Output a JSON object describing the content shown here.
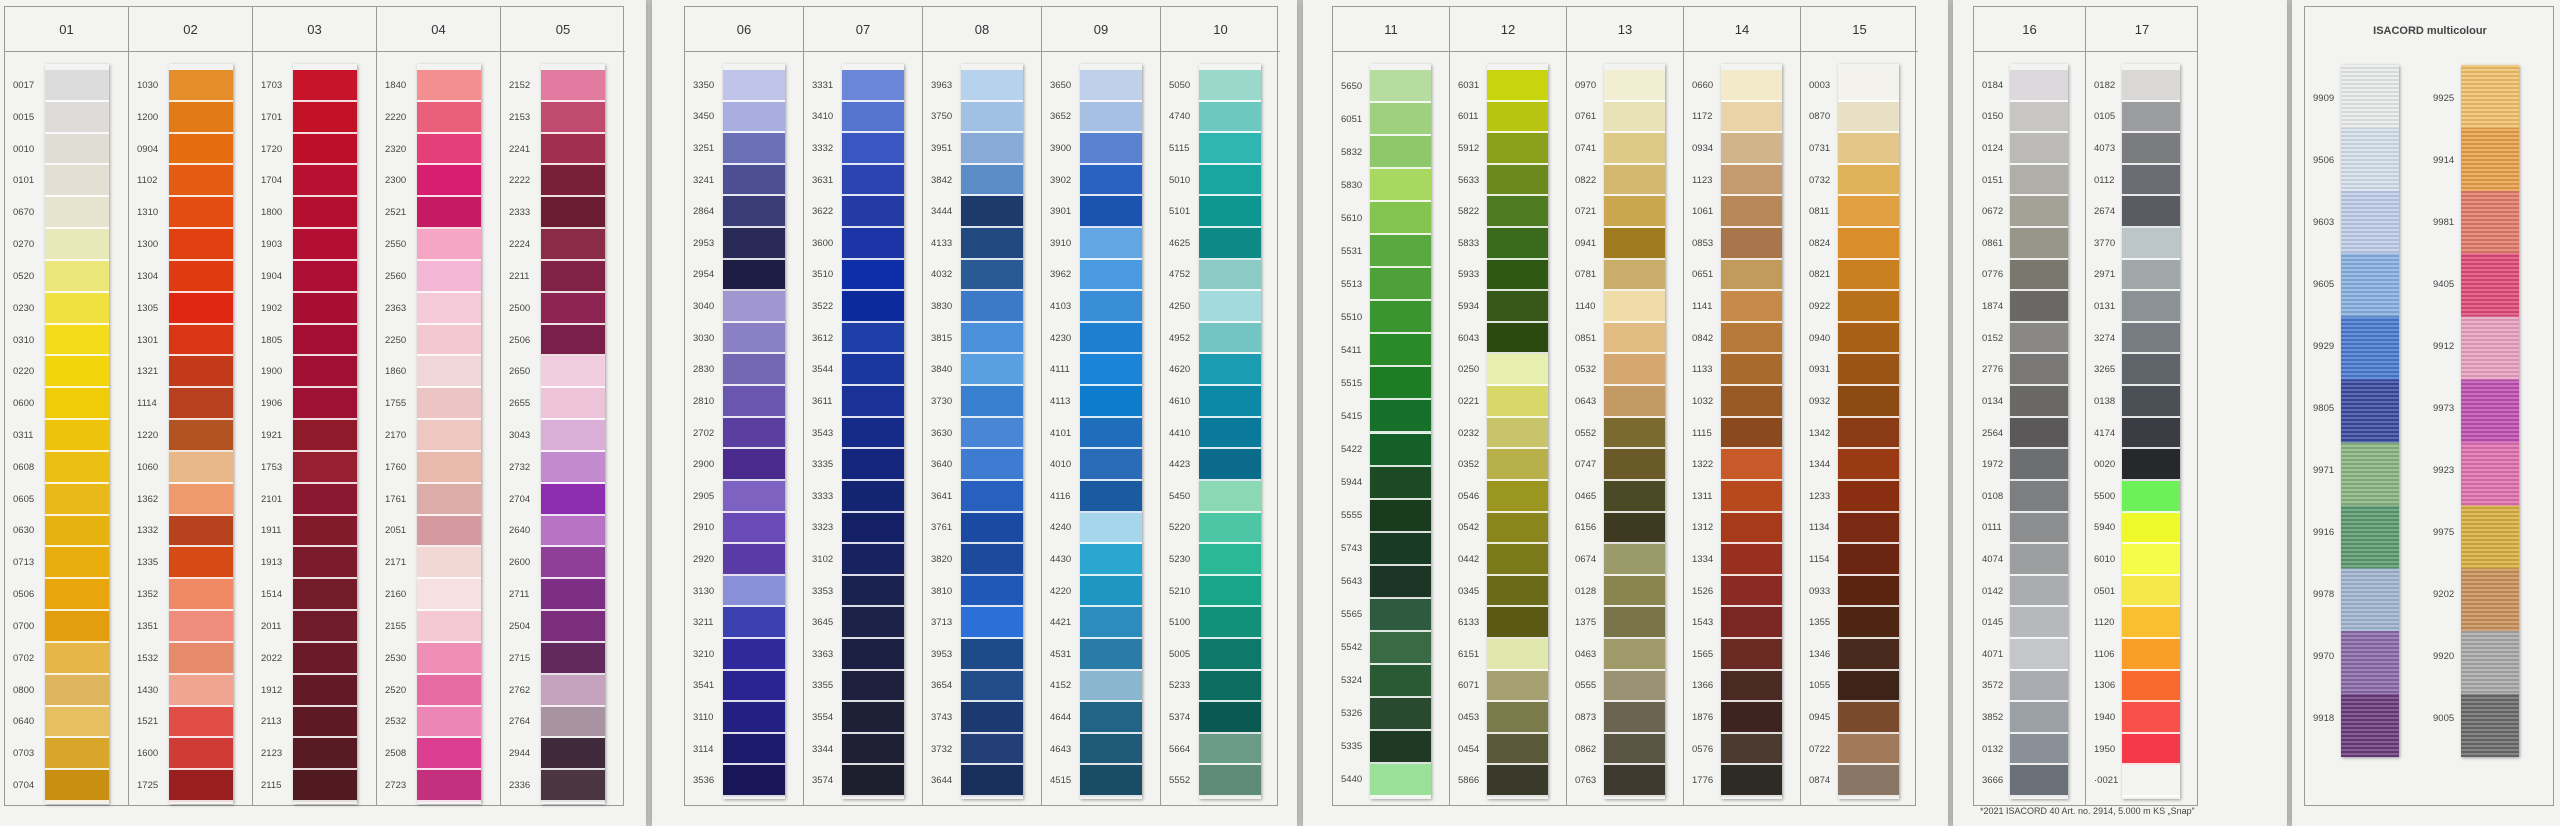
{
  "cards": [
    {
      "columns": [
        {
          "title": "01",
          "codes": [
            "0017",
            "0015",
            "0010",
            "0101",
            "0670",
            "0270",
            "0520",
            "0230",
            "0310",
            "0220",
            "0600",
            "0311",
            "0608",
            "0605",
            "0630",
            "0713",
            "0506",
            "0700",
            "0702",
            "0800",
            "0640",
            "0703",
            "0704"
          ],
          "colors": [
            "#dcdcdc",
            "#dedcd9",
            "#e0ddd5",
            "#e3e0d3",
            "#e6e3cf",
            "#e9e8b8",
            "#ece67a",
            "#f0e040",
            "#f3dc1a",
            "#f2d50c",
            "#efcb08",
            "#eec30b",
            "#ecbf16",
            "#e9b91a",
            "#e6b20f",
            "#e9ad0d",
            "#e9a60c",
            "#e39e10",
            "#e7b648",
            "#dcb55c",
            "#e6c060",
            "#d8a62a",
            "#c88f10"
          ]
        },
        {
          "title": "02",
          "codes": [
            "1030",
            "1200",
            "0904",
            "1102",
            "1310",
            "1300",
            "1304",
            "1305",
            "1301",
            "1321",
            "1114",
            "1220",
            "1060",
            "1362",
            "1332",
            "1335",
            "1352",
            "1351",
            "1532",
            "1430",
            "1521",
            "1600",
            "1725"
          ],
          "colors": [
            "#e58d28",
            "#e27a19",
            "#e66c12",
            "#e45c12",
            "#e34d11",
            "#e14110",
            "#df3a12",
            "#e02712",
            "#d83614",
            "#c23a1a",
            "#b8401e",
            "#b35223",
            "#e9b88a",
            "#ef9a6c",
            "#b7421e",
            "#d64a16",
            "#f08a66",
            "#f08c7c",
            "#e58a6a",
            "#f0a492",
            "#e04d45",
            "#d03a37",
            "#9a2020"
          ]
        },
        {
          "title": "03",
          "codes": [
            "1703",
            "1701",
            "1720",
            "1704",
            "1800",
            "1903",
            "1904",
            "1902",
            "1805",
            "1900",
            "1906",
            "1921",
            "1753",
            "2101",
            "1911",
            "1913",
            "1514",
            "2011",
            "2022",
            "1912",
            "2113",
            "2123",
            "2115"
          ],
          "colors": [
            "#c8142a",
            "#c31226",
            "#bd1028",
            "#b81030",
            "#b40f2e",
            "#b20f32",
            "#ad0f34",
            "#a80e32",
            "#a40e33",
            "#a10f32",
            "#9e1034",
            "#8f1a2a",
            "#962032",
            "#8c1730",
            "#831a2c",
            "#7c1b2c",
            "#751c2a",
            "#701b2a",
            "#6a1a28",
            "#641a26",
            "#5e1a24",
            "#581a22",
            "#501a20"
          ]
        },
        {
          "title": "04",
          "codes": [
            "1840",
            "2220",
            "2320",
            "2300",
            "2521",
            "2550",
            "2560",
            "2363",
            "2250",
            "1860",
            "1755",
            "2170",
            "1760",
            "1761",
            "2051",
            "2171",
            "2160",
            "2155",
            "2530",
            "2520",
            "2532",
            "2508",
            "2723"
          ],
          "colors": [
            "#f38f8e",
            "#e9607a",
            "#e43f78",
            "#d81e70",
            "#c51a64",
            "#f4a6c4",
            "#f3b6d4",
            "#f5cad8",
            "#f3c9cf",
            "#f1d6d8",
            "#ecc4c4",
            "#eec8c0",
            "#eab9ae",
            "#dcada8",
            "#d59aa0",
            "#f2d8d4",
            "#f6e0e0",
            "#f4c9d5",
            "#ef8fb8",
            "#e66ba2",
            "#ec86b4",
            "#dc3f92",
            "#c2307e"
          ]
        },
        {
          "title": "05",
          "codes": [
            "2152",
            "2153",
            "2241",
            "2222",
            "2333",
            "2224",
            "2211",
            "2500",
            "2506",
            "2650",
            "2655",
            "3043",
            "2732",
            "2704",
            "2640",
            "2600",
            "2711",
            "2504",
            "2715",
            "2762",
            "2764",
            "2944",
            "2336"
          ],
          "colors": [
            "#e27ba0",
            "#c04a70",
            "#a0304e",
            "#7a1f38",
            "#6a1c33",
            "#8b2b4a",
            "#7f2245",
            "#8d2552",
            "#7a1e4a",
            "#f2cde0",
            "#ecc3d8",
            "#d9aed7",
            "#c28bd0",
            "#8f2db0",
            "#b774c4",
            "#8f3f98",
            "#7d2f86",
            "#7a2e7c",
            "#622a5c",
            "#c5a3bf",
            "#a893a2",
            "#3e2a3a",
            "#4a3540"
          ]
        }
      ]
    },
    {
      "columns": [
        {
          "title": "06",
          "codes": [
            "3350",
            "3450",
            "3251",
            "3241",
            "2864",
            "2953",
            "2954",
            "3040",
            "3030",
            "2830",
            "2810",
            "2702",
            "2900",
            "2905",
            "2910",
            "2920",
            "3130",
            "3211",
            "3210",
            "3541",
            "3110",
            "3114",
            "3536"
          ],
          "colors": [
            "#c0c4e8",
            "#a8aee0",
            "#6c70b6",
            "#4c4f92",
            "#3a3c78",
            "#2a2a58",
            "#1e1e44",
            "#a096d0",
            "#8a80c6",
            "#7468b4",
            "#6a56ae",
            "#5a3ea0",
            "#4a2a8c",
            "#7e62c2",
            "#6a4ab6",
            "#5a3aa4",
            "#8a90d8",
            "#3a40b0",
            "#2e2a9c",
            "#2a2490",
            "#222080",
            "#1c1a6a",
            "#181656"
          ]
        },
        {
          "title": "07",
          "codes": [
            "3331",
            "3410",
            "3332",
            "3631",
            "3622",
            "3600",
            "3510",
            "3522",
            "3612",
            "3544",
            "3611",
            "3543",
            "3335",
            "3333",
            "3323",
            "3102",
            "3353",
            "3645",
            "3363",
            "3355",
            "3554",
            "3344",
            "3574"
          ],
          "colors": [
            "#6a86d8",
            "#5474d0",
            "#3a56c0",
            "#2c44b0",
            "#243aa4",
            "#1c34a6",
            "#0e2ea8",
            "#0c2a9c",
            "#1e3ea8",
            "#1c36a0",
            "#1a3298",
            "#162a8a",
            "#14267e",
            "#132470",
            "#142066",
            "#18225e",
            "#1a2250",
            "#1c2248",
            "#1c2042",
            "#1e213e",
            "#1e2038",
            "#1f2034",
            "#1d1e2e"
          ]
        },
        {
          "title": "08",
          "codes": [
            "3963",
            "3750",
            "3951",
            "3842",
            "3444",
            "4133",
            "4032",
            "3830",
            "3815",
            "3840",
            "3730",
            "3630",
            "3640",
            "3641",
            "3761",
            "3820",
            "3810",
            "3713",
            "3953",
            "3654",
            "3743",
            "3732",
            "3644"
          ],
          "colors": [
            "#b6d2ec",
            "#a0c0e4",
            "#88aad6",
            "#5a8cc6",
            "#1e3a6a",
            "#214a80",
            "#2a5a96",
            "#3a7ac6",
            "#4a90da",
            "#5aa0e0",
            "#3880d0",
            "#4a86d6",
            "#3e7cd2",
            "#2860c0",
            "#1a4aa2",
            "#1c4a9c",
            "#2058b8",
            "#2a70d8",
            "#1e4a8a",
            "#224c8a",
            "#1c3a70",
            "#243e76",
            "#1a2e5c"
          ]
        },
        {
          "title": "09",
          "codes": [
            "3650",
            "3652",
            "3900",
            "3902",
            "3901",
            "3910",
            "3962",
            "4103",
            "4230",
            "4111",
            "4113",
            "4101",
            "4010",
            "4116",
            "4240",
            "4430",
            "4220",
            "4421",
            "4531",
            "4152",
            "4644",
            "4643",
            "4515"
          ],
          "colors": [
            "#c0d0ea",
            "#a6c0e4",
            "#5a82d0",
            "#2a62c2",
            "#1a54b0",
            "#62a6e4",
            "#4a9ae0",
            "#3a8ed8",
            "#1e7ed0",
            "#1a84d8",
            "#0e7ccc",
            "#1e6ebc",
            "#2a6cb8",
            "#1a5aa0",
            "#a6d6ec",
            "#2aa6d0",
            "#1e96c4",
            "#2c8cbc",
            "#2a7ca6",
            "#8ab6d0",
            "#226486",
            "#1e5a78",
            "#1a4c66"
          ]
        },
        {
          "title": "10",
          "codes": [
            "5050",
            "4740",
            "5115",
            "5010",
            "5101",
            "4625",
            "4752",
            "4250",
            "4952",
            "4620",
            "4610",
            "4410",
            "4423",
            "5450",
            "5220",
            "5230",
            "5210",
            "5100",
            "5005",
            "5233",
            "5374",
            "5664",
            "5552"
          ],
          "colors": [
            "#9ad8cc",
            "#6cc8c0",
            "#30b6b0",
            "#1aa6a0",
            "#0e9690",
            "#0e8a86",
            "#8ccac6",
            "#a4dade",
            "#74c4c4",
            "#1c9cb0",
            "#0a88a6",
            "#0a7a9a",
            "#0a6c8a",
            "#8ad8b4",
            "#4cc6a4",
            "#2ab896",
            "#18a688",
            "#12907a",
            "#0e786a",
            "#0c6c60",
            "#0a5a52",
            "#6a9a88",
            "#5e8a78"
          ]
        }
      ]
    },
    {
      "columns": [
        {
          "title": "11",
          "codes": [
            "5650",
            "6051",
            "5832",
            "5830",
            "5610",
            "5531",
            "5513",
            "5510",
            "5411",
            "5515",
            "5415",
            "5422",
            "5944",
            "5555",
            "5743",
            "5643",
            "5565",
            "5542",
            "5324",
            "5326",
            "5335",
            "5440"
          ],
          "colors": [
            "#b6dca0",
            "#9ed07e",
            "#8ec86a",
            "#a8d860",
            "#84c450",
            "#5aa840",
            "#4ea038",
            "#3a9430",
            "#2a8a2a",
            "#1e7c26",
            "#16702a",
            "#146028",
            "#1c4a22",
            "#1a3a1e",
            "#193a24",
            "#1c3626",
            "#2e5a40",
            "#3a6a44",
            "#2a5a34",
            "#2a4a30",
            "#1e3a24",
            "#9ae098"
          ]
        },
        {
          "title": "12",
          "codes": [
            "6031",
            "6011",
            "5912",
            "5633",
            "5822",
            "5833",
            "5933",
            "5934",
            "6043",
            "0250",
            "0221",
            "0232",
            "0352",
            "0546",
            "0542",
            "0442",
            "0345",
            "6133",
            "6151",
            "6071",
            "0453",
            "0454",
            "5866"
          ],
          "colors": [
            "#c8d40e",
            "#b8c412",
            "#8aa01a",
            "#6a8a1e",
            "#4e7a20",
            "#3a6a1c",
            "#2e5814",
            "#38581a",
            "#2a4a10",
            "#e8f0b0",
            "#d8d868",
            "#c8c46a",
            "#b8b04a",
            "#9a9620",
            "#8a861e",
            "#7a7a1a",
            "#6a6a1a",
            "#5a5a14",
            "#e0e8b0",
            "#a4a070",
            "#7a7a4a",
            "#5a5a3a",
            "#3a3a2a"
          ]
        },
        {
          "title": "13",
          "codes": [
            "0970",
            "0761",
            "0741",
            "0822",
            "0721",
            "0941",
            "0781",
            "1140",
            "0851",
            "0532",
            "0643",
            "0552",
            "0747",
            "0465",
            "6156",
            "0674",
            "0128",
            "1375",
            "0463",
            "0555",
            "0873",
            "0862",
            "0763"
          ],
          "colors": [
            "#f2eed4",
            "#e8e2b6",
            "#dcca86",
            "#d2b870",
            "#caa64e",
            "#a07a1e",
            "#c8ae6a",
            "#f0dca8",
            "#e0bc82",
            "#d4a870",
            "#c49a64",
            "#7a6a30",
            "#6a5a2a",
            "#4a4a26",
            "#3e3a22",
            "#9a9a6a",
            "#8a8450",
            "#7a744a",
            "#a09a6a",
            "#9a9272",
            "#6a6450",
            "#5a5444",
            "#3e3a30"
          ]
        },
        {
          "title": "14",
          "codes": [
            "0660",
            "1172",
            "0934",
            "1123",
            "1061",
            "0853",
            "0651",
            "1141",
            "0842",
            "1133",
            "1032",
            "1115",
            "1322",
            "1311",
            "1312",
            "1334",
            "1526",
            "1543",
            "1565",
            "1366",
            "1876",
            "0576",
            "1776"
          ],
          "colors": [
            "#f2eac8",
            "#e8d4a6",
            "#d2b48a",
            "#c49a6e",
            "#b8885a",
            "#a8764a",
            "#c29a5c",
            "#c88a48",
            "#b87a3a",
            "#a86a2e",
            "#9a5a26",
            "#8a4a1e",
            "#c85a2a",
            "#b8481e",
            "#a83a1c",
            "#983020",
            "#8a2a22",
            "#7a2622",
            "#6a2a24",
            "#4a2a22",
            "#3e2420",
            "#4a3a30",
            "#2e2a26"
          ]
        },
        {
          "title": "15",
          "codes": [
            "0003",
            "0870",
            "0731",
            "0732",
            "0811",
            "0824",
            "0821",
            "0922",
            "0940",
            "0931",
            "0932",
            "1342",
            "1344",
            "1233",
            "1134",
            "1154",
            "0933",
            "1355",
            "1346",
            "1055",
            "0945",
            "0722",
            "0874"
          ],
          "colors": [
            "#f4f2ec",
            "#e8e0c4",
            "#e2c68a",
            "#e0b25a",
            "#e0a040",
            "#d88e2a",
            "#c88020",
            "#b8701a",
            "#a86016",
            "#9a5414",
            "#8a4a12",
            "#8a3a14",
            "#9a3a14",
            "#8a2e12",
            "#7a2a12",
            "#6a2612",
            "#5a2410",
            "#4e2412",
            "#4a2a1c",
            "#3e2418",
            "#7a4a2c",
            "#a07a5a",
            "#8a7664"
          ]
        }
      ]
    },
    {
      "columns": [
        {
          "title": "16",
          "codes": [
            "0184",
            "0150",
            "0124",
            "0151",
            "0672",
            "0861",
            "0776",
            "1874",
            "0152",
            "2776",
            "0134",
            "2564",
            "1972",
            "0108",
            "0111",
            "4074",
            "0142",
            "0145",
            "4071",
            "3572",
            "3852",
            "0132",
            "3666"
          ],
          "colors": [
            "#dcd8dc",
            "#c8c6c4",
            "#bcbab6",
            "#b0aea8",
            "#a4a296",
            "#989688",
            "#7a786e",
            "#6a6864",
            "#8a8886",
            "#7a7876",
            "#6a6866",
            "#5a5858",
            "#6c6e70",
            "#7c7e80",
            "#8c8e90",
            "#9c9ea0",
            "#aaacb0",
            "#b6b8bc",
            "#c4c6ca",
            "#a8acb0",
            "#9aa0a6",
            "#8a9098",
            "#6a7078"
          ]
        },
        {
          "title": "17",
          "codes": [
            "0182",
            "0105",
            "4073",
            "0112",
            "2674",
            "3770",
            "2971",
            "0131",
            "3274",
            "3265",
            "0138",
            "4174",
            "0020",
            "5500",
            "5940",
            "6010",
            "0501",
            "1120",
            "1106",
            "1306",
            "1940",
            "1950",
            "·0021"
          ],
          "colors": [
            "#dad8d6",
            "#9a9c9e",
            "#7a7c80",
            "#6a6c74",
            "#5a5c64",
            "#bcc6c8",
            "#a0a8aa",
            "#8a9296",
            "#767c82",
            "#5e646a",
            "#4a5056",
            "#3a3e44",
            "#26282c",
            "#6ef05a",
            "#eef82a",
            "#f6fc4a",
            "#f4e84a",
            "#f8c030",
            "#fa9e2a",
            "#fa6a2e",
            "#f8504a",
            "#f43a4a",
            "#f4f4f2"
          ]
        }
      ]
    }
  ],
  "multicolour": {
    "title": "ISACORD multicolour",
    "left_codes": [
      "9909",
      "9506",
      "9603",
      "9605",
      "9929",
      "9805",
      "9971",
      "9916",
      "9978",
      "9970",
      "9918"
    ],
    "right_codes": [
      "9925",
      "9914",
      "9981",
      "9405",
      "9912",
      "9973",
      "9923",
      "9975",
      "9202",
      "9920",
      "9005"
    ],
    "left_bands": [
      "#e8ecea",
      "#d4e0ec",
      "#c0cce8",
      "#86b0e0",
      "#4a7ad0",
      "#3a4aa0",
      "#8ab480",
      "#5a9a70",
      "#a0b4d0",
      "#8a6aa8",
      "#6a3a7a"
    ],
    "right_bands": [
      "#f0c06a",
      "#e8a04a",
      "#e07a6a",
      "#e04a7a",
      "#e8a0c0",
      "#c050b0",
      "#e070b0",
      "#d8b040",
      "#c8905a",
      "#a8a8a8",
      "#6a6a6a"
    ]
  },
  "caption": "*2021 ISACORD 40 Art. no. 2914, 5.000 m KS „Snap“"
}
